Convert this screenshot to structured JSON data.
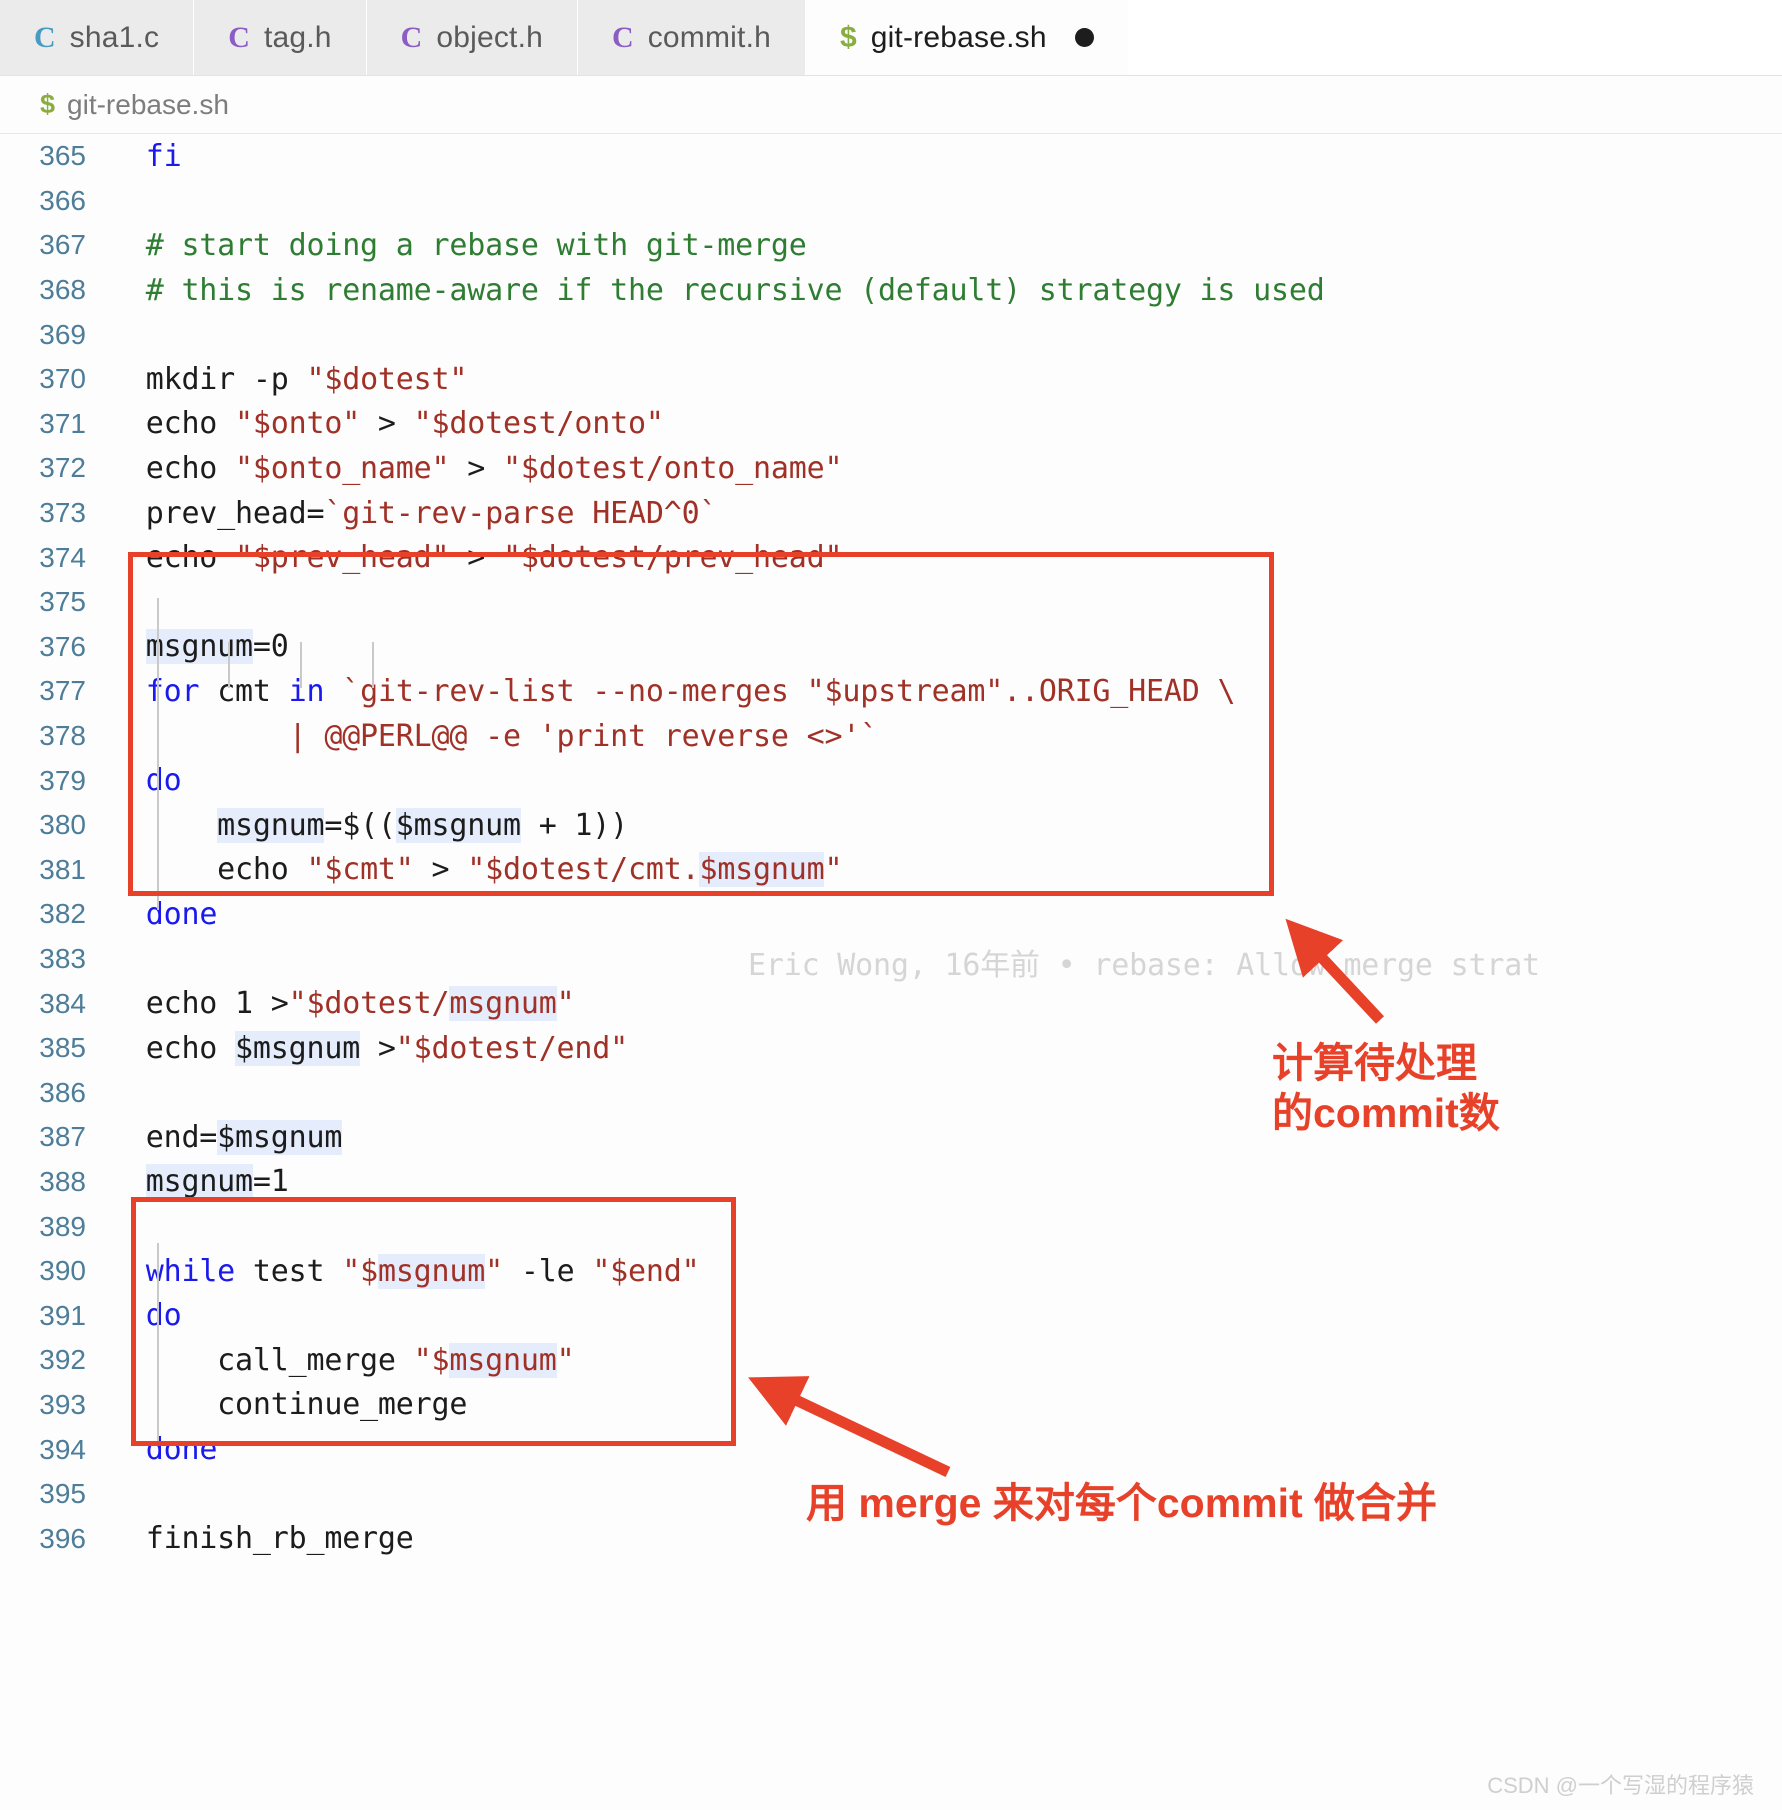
{
  "tabs": [
    {
      "label": "sha1.c",
      "icon": "c-file-icon",
      "icon_glyph": "C",
      "icon_class": "icon-c-blue",
      "active": false,
      "dirty": false
    },
    {
      "label": "tag.h",
      "icon": "c-file-icon",
      "icon_glyph": "C",
      "icon_class": "icon-c-purple",
      "active": false,
      "dirty": false
    },
    {
      "label": "object.h",
      "icon": "c-file-icon",
      "icon_glyph": "C",
      "icon_class": "icon-c-purple",
      "active": false,
      "dirty": false
    },
    {
      "label": "commit.h",
      "icon": "c-file-icon",
      "icon_glyph": "C",
      "icon_class": "icon-c-purple",
      "active": false,
      "dirty": false
    },
    {
      "label": "git-rebase.sh",
      "icon": "shell-file-icon",
      "icon_glyph": "$",
      "icon_class": "icon-sh",
      "active": true,
      "dirty": true
    }
  ],
  "breadcrumb": {
    "icon": "shell-file-icon",
    "icon_glyph": "$",
    "label": "git-rebase.sh"
  },
  "blame": {
    "text": "Eric Wong, 16年前 • rebase: Allow merge strat"
  },
  "annotations": [
    {
      "id": "annot-1",
      "text": "计算待处理\n的commit数"
    },
    {
      "id": "annot-2",
      "text": "用 merge 来对每个commit 做合并"
    }
  ],
  "watermark": {
    "text": "CSDN @一个写湿的程序猿"
  },
  "colors": {
    "accent_red": "#e8412a",
    "keyword": "#1a1aee",
    "comment": "#2e7d32",
    "string": "#a03127",
    "lineno": "#4d7d99",
    "highlight": "#e5ecfb",
    "blame": "#d5d5d5"
  },
  "code": {
    "first_line": 365,
    "lines": [
      {
        "n": 365,
        "tokens": [
          {
            "t": "  ",
            "c": "pln"
          },
          {
            "t": "fi",
            "c": "kw"
          }
        ]
      },
      {
        "n": 366,
        "tokens": []
      },
      {
        "n": 367,
        "tokens": [
          {
            "t": "  # start doing a rebase with git-merge",
            "c": "cmt"
          }
        ]
      },
      {
        "n": 368,
        "tokens": [
          {
            "t": "  # this is rename-aware if the recursive (default) strategy is used",
            "c": "cmt"
          }
        ]
      },
      {
        "n": 369,
        "tokens": []
      },
      {
        "n": 370,
        "tokens": [
          {
            "t": "  mkdir -p ",
            "c": "pln"
          },
          {
            "t": "\"$dotest\"",
            "c": "str"
          }
        ]
      },
      {
        "n": 371,
        "tokens": [
          {
            "t": "  echo ",
            "c": "pln"
          },
          {
            "t": "\"$onto\"",
            "c": "str"
          },
          {
            "t": " > ",
            "c": "pln"
          },
          {
            "t": "\"$dotest/onto\"",
            "c": "str"
          }
        ]
      },
      {
        "n": 372,
        "tokens": [
          {
            "t": "  echo ",
            "c": "pln"
          },
          {
            "t": "\"$onto_name\"",
            "c": "str"
          },
          {
            "t": " > ",
            "c": "pln"
          },
          {
            "t": "\"$dotest/onto_name\"",
            "c": "str"
          }
        ]
      },
      {
        "n": 373,
        "tokens": [
          {
            "t": "  prev_head=",
            "c": "pln"
          },
          {
            "t": "`git-rev-parse HEAD^0`",
            "c": "str"
          }
        ]
      },
      {
        "n": 374,
        "tokens": [
          {
            "t": "  echo ",
            "c": "pln"
          },
          {
            "t": "\"$prev_head\"",
            "c": "str"
          },
          {
            "t": " > ",
            "c": "pln"
          },
          {
            "t": "\"$dotest/prev_head\"",
            "c": "str"
          }
        ]
      },
      {
        "n": 375,
        "tokens": []
      },
      {
        "n": 376,
        "tokens": [
          {
            "t": "  ",
            "c": "pln"
          },
          {
            "t": "msgnum",
            "c": "pln hl"
          },
          {
            "t": "=0",
            "c": "pln"
          }
        ]
      },
      {
        "n": 377,
        "tokens": [
          {
            "t": "  ",
            "c": "pln"
          },
          {
            "t": "for",
            "c": "kw"
          },
          {
            "t": " cmt ",
            "c": "pln"
          },
          {
            "t": "in",
            "c": "kw"
          },
          {
            "t": " ",
            "c": "pln"
          },
          {
            "t": "`git-rev-list --no-merges \"$upstream\"..ORIG_HEAD \\",
            "c": "str"
          }
        ]
      },
      {
        "n": 378,
        "tokens": [
          {
            "t": "          | @@PERL@@ -e 'print reverse <>'`",
            "c": "str"
          }
        ]
      },
      {
        "n": 379,
        "tokens": [
          {
            "t": "  ",
            "c": "pln"
          },
          {
            "t": "do",
            "c": "kw"
          }
        ]
      },
      {
        "n": 380,
        "tokens": [
          {
            "t": "      ",
            "c": "pln"
          },
          {
            "t": "msgnum",
            "c": "pln hl"
          },
          {
            "t": "=$((",
            "c": "pln"
          },
          {
            "t": "$msgnum",
            "c": "pln hl"
          },
          {
            "t": " + 1))",
            "c": "pln"
          }
        ]
      },
      {
        "n": 381,
        "tokens": [
          {
            "t": "      echo ",
            "c": "pln"
          },
          {
            "t": "\"$cmt\"",
            "c": "str"
          },
          {
            "t": " > ",
            "c": "pln"
          },
          {
            "t": "\"$dotest/cmt.",
            "c": "str"
          },
          {
            "t": "$msgnum",
            "c": "str hl"
          },
          {
            "t": "\"",
            "c": "str"
          }
        ]
      },
      {
        "n": 382,
        "tokens": [
          {
            "t": "  ",
            "c": "pln"
          },
          {
            "t": "done",
            "c": "kw"
          }
        ]
      },
      {
        "n": 383,
        "tokens": []
      },
      {
        "n": 384,
        "tokens": [
          {
            "t": "  echo 1 >",
            "c": "pln"
          },
          {
            "t": "\"$dotest/",
            "c": "str"
          },
          {
            "t": "msgnum",
            "c": "str hl"
          },
          {
            "t": "\"",
            "c": "str"
          }
        ]
      },
      {
        "n": 385,
        "tokens": [
          {
            "t": "  echo ",
            "c": "pln"
          },
          {
            "t": "$msgnum",
            "c": "pln hl"
          },
          {
            "t": " >",
            "c": "pln"
          },
          {
            "t": "\"$dotest/end\"",
            "c": "str"
          }
        ]
      },
      {
        "n": 386,
        "tokens": []
      },
      {
        "n": 387,
        "tokens": [
          {
            "t": "  end=",
            "c": "pln"
          },
          {
            "t": "$msgnum",
            "c": "pln hl"
          }
        ]
      },
      {
        "n": 388,
        "tokens": [
          {
            "t": "  ",
            "c": "pln"
          },
          {
            "t": "msgnum",
            "c": "pln hl"
          },
          {
            "t": "=1",
            "c": "pln"
          }
        ]
      },
      {
        "n": 389,
        "tokens": []
      },
      {
        "n": 390,
        "tokens": [
          {
            "t": "  ",
            "c": "pln"
          },
          {
            "t": "while",
            "c": "kw"
          },
          {
            "t": " test ",
            "c": "pln"
          },
          {
            "t": "\"$",
            "c": "str"
          },
          {
            "t": "msgnum",
            "c": "str hl"
          },
          {
            "t": "\"",
            "c": "str"
          },
          {
            "t": " -le ",
            "c": "pln"
          },
          {
            "t": "\"$end\"",
            "c": "str"
          }
        ]
      },
      {
        "n": 391,
        "tokens": [
          {
            "t": "  ",
            "c": "pln"
          },
          {
            "t": "do",
            "c": "kw"
          }
        ]
      },
      {
        "n": 392,
        "tokens": [
          {
            "t": "      call_merge ",
            "c": "pln"
          },
          {
            "t": "\"$",
            "c": "str"
          },
          {
            "t": "msgnum",
            "c": "str hl"
          },
          {
            "t": "\"",
            "c": "str"
          }
        ]
      },
      {
        "n": 393,
        "tokens": [
          {
            "t": "      continue_merge",
            "c": "pln"
          }
        ]
      },
      {
        "n": 394,
        "tokens": [
          {
            "t": "  ",
            "c": "pln"
          },
          {
            "t": "done",
            "c": "kw"
          }
        ]
      },
      {
        "n": 395,
        "tokens": []
      },
      {
        "n": 396,
        "tokens": [
          {
            "t": "  finish_rb_merge",
            "c": "pln"
          }
        ]
      }
    ]
  }
}
